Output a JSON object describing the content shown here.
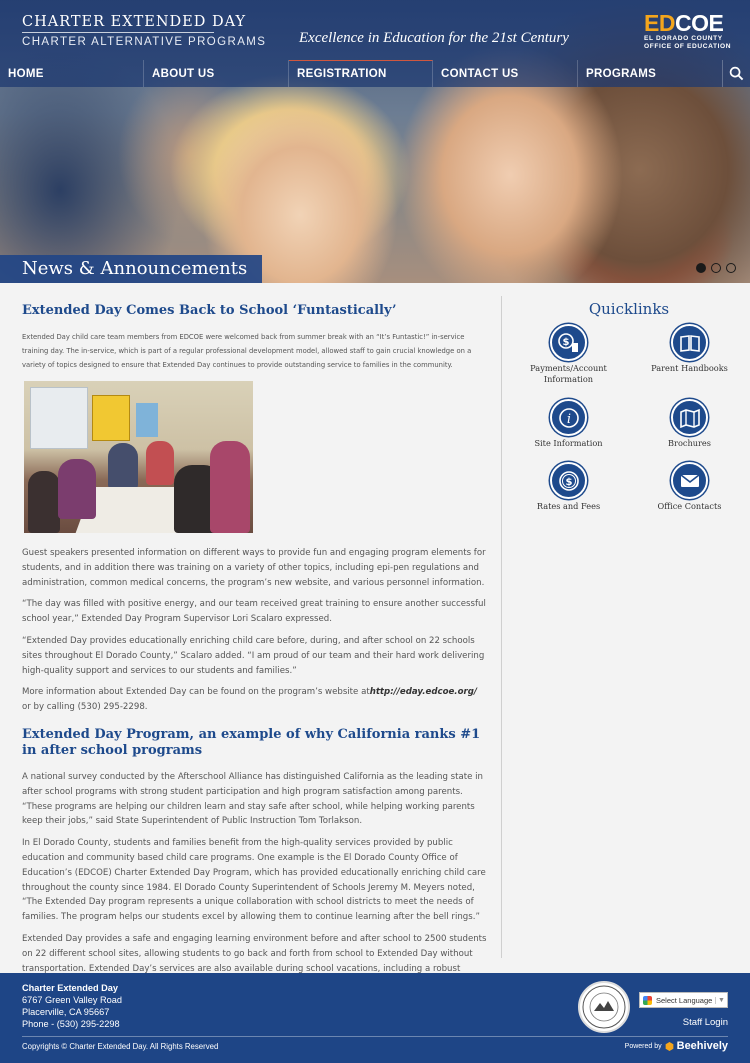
{
  "header": {
    "brand_line1": "CHARTER EXTENDED DAY",
    "brand_line2": "CHARTER ALTERNATIVE PROGRAMS",
    "tagline": "Excellence in Education for the 21st Century",
    "edcoe_ed": "ED",
    "edcoe_coe": "COE",
    "edcoe_sub1": "EL DORADO COUNTY",
    "edcoe_sub2": "OFFICE OF EDUCATION"
  },
  "nav": {
    "items": [
      "HOME",
      "ABOUT US",
      "REGISTRATION",
      "CONTACT US",
      "PROGRAMS"
    ],
    "search_icon": "search-icon"
  },
  "hero": {
    "banner": "News & Announcements",
    "slides": 3,
    "active_slide": 1
  },
  "articles": [
    {
      "title": "Extended Day Comes Back to School ‘Funtastically’",
      "intro": "Extended Day child care team members from EDCOE were welcomed back from summer break with an “It’s Funtastic!” in-service training day.  The in-service, which is part of a regular professional development model, allowed staff to gain crucial knowledge on a variety of topics designed to ensure that Extended Day continues to provide outstanding service to families in the community.",
      "p1": "Guest speakers presented information on different ways to provide fun and engaging program elements for students, and in addition there was training on a variety of other topics, including epi-pen regulations and administration, common medical concerns, the program’s new website, and various personnel information.",
      "p2": "“The day was filled with positive energy, and our team received great training to ensure another successful school year,” Extended Day Program Supervisor Lori Scalaro expressed.",
      "p3": "“Extended Day provides educationally enriching child care before, during, and after school on 22 schools sites throughout El Dorado County,” Scalaro added.  “I am proud of our team and their hard work delivering high-quality support and services to our students and families.”",
      "p4_before": "More information about Extended Day can be found on the program’s website at",
      "p4_link": "http://eday.edcoe.org/",
      "p4_after": " or by calling (530) 295-2298."
    },
    {
      "title": "Extended Day Program, an example of why California ranks #1 in after school programs",
      "p1": "A national survey conducted by the Afterschool Alliance has distinguished California as the leading state in after school programs with strong student participation and high program satisfaction among parents. “These programs are helping our children learn and stay safe after school, while helping working parents keep their jobs,” said State Superintendent of Public Instruction Tom Torlakson.",
      "p2": "In El Dorado County, students and families benefit from the high-quality services provided by public education and community based child care programs. One example is the El Dorado County Office of Education’s (EDCOE) Charter Extended Day Program, which has provided educationally enriching child care throughout the county since 1984. El Dorado County Superintendent of Schools Jeremy M. Meyers noted, “The Extended Day program represents a unique collaboration with school districts to meet the needs of families. The program helps our students excel by allowing them to continue learning after the bell rings.”",
      "p3": "Extended Day provides a safe and engaging learning environment before and after school to 2500 students on 22 different school sites, allowing students to go back and forth from school to Extended Day without transportation. Extended Day’s services are also available during school vacations, including a robust summer program."
    }
  ],
  "quicklinks": {
    "title": "Quicklinks",
    "items": [
      {
        "label": "Payments/Account Information",
        "icon": "payment-icon"
      },
      {
        "label": "Parent Handbooks",
        "icon": "book-icon"
      },
      {
        "label": "Site Information",
        "icon": "info-icon"
      },
      {
        "label": "Brochures",
        "icon": "map-brochure-icon"
      },
      {
        "label": "Rates and Fees",
        "icon": "dollar-coin-icon"
      },
      {
        "label": "Office Contacts",
        "icon": "envelope-icon"
      }
    ]
  },
  "footer": {
    "org": "Charter Extended Day",
    "street": "6767 Green Valley Road",
    "city": "Placerville, CA 95667",
    "phone": "Phone - (530) 295-2298",
    "language": "Select Language",
    "staff_login": "Staff Login",
    "copyright": "Copyrights © Charter Extended Day. All Rights Reserved",
    "powered_by": "Powered by",
    "powered_brand": "Beehively"
  }
}
